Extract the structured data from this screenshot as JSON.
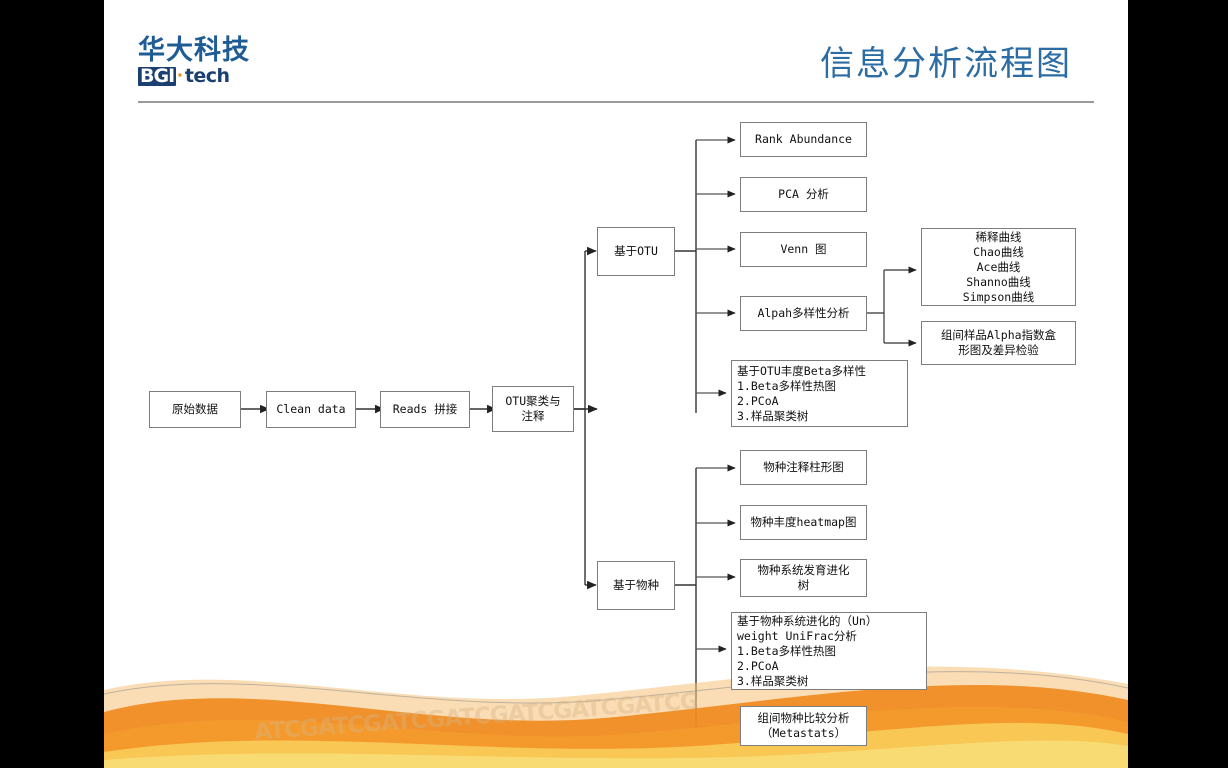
{
  "slide": {
    "title": "信息分析流程图",
    "logo": {
      "chinese": "华大科技",
      "brand": "BGI",
      "dot": "·",
      "suffix": "tech"
    },
    "decor_text": "ATCGATCGATCGATCGATCGATCGATCG",
    "colors": {
      "title": "#2b6ca3",
      "logo_blue": "#1f5c96",
      "logo_dark": "#1b3f70",
      "logo_orange": "#e8861d",
      "box_border": "#7d7d7d",
      "connector": "#333333",
      "wave_orange": "#ef8a1f",
      "wave_light": "#f6b955",
      "wave_yellow": "#f8d648"
    }
  },
  "flow": {
    "main_chain": [
      {
        "id": "raw",
        "label": "原始数据"
      },
      {
        "id": "clean",
        "label": "Clean data"
      },
      {
        "id": "reads",
        "label": "Reads 拼接"
      },
      {
        "id": "otu",
        "label": "OTU聚类与\n注释"
      }
    ],
    "branches": [
      {
        "id": "by-otu",
        "label": "基于OTU"
      },
      {
        "id": "by-species",
        "label": "基于物种"
      }
    ],
    "otu_outputs": [
      {
        "id": "rank-abundance",
        "label": "Rank Abundance"
      },
      {
        "id": "pca",
        "label": "PCA 分析"
      },
      {
        "id": "venn",
        "label": "Venn 图"
      },
      {
        "id": "alpha",
        "label": "Alpah多样性分析"
      },
      {
        "id": "beta-otu",
        "label": "基于OTU丰度Beta多样性\n1.Beta多样性热图\n2.PCoA\n3.样品聚类树"
      }
    ],
    "alpha_outputs": [
      {
        "id": "curves",
        "label": "稀释曲线\nChao曲线\nAce曲线\nShanno曲线\nSimpson曲线"
      },
      {
        "id": "alpha-boxes",
        "label": "组间样品Alpha指数盒\n形图及差异检验"
      }
    ],
    "species_outputs": [
      {
        "id": "sp-bar",
        "label": "物种注释柱形图"
      },
      {
        "id": "sp-heatmap",
        "label": "物种丰度heatmap图"
      },
      {
        "id": "sp-tree",
        "label": "物种系统发育进化\n树"
      },
      {
        "id": "unifrac",
        "label": "基于物种系统进化的（Un）\nweight UniFrac分析\n1.Beta多样性热图\n2.PCoA\n3.样品聚类树"
      },
      {
        "id": "metastats",
        "label": "组间物种比较分析\n（Metastats）"
      }
    ]
  }
}
